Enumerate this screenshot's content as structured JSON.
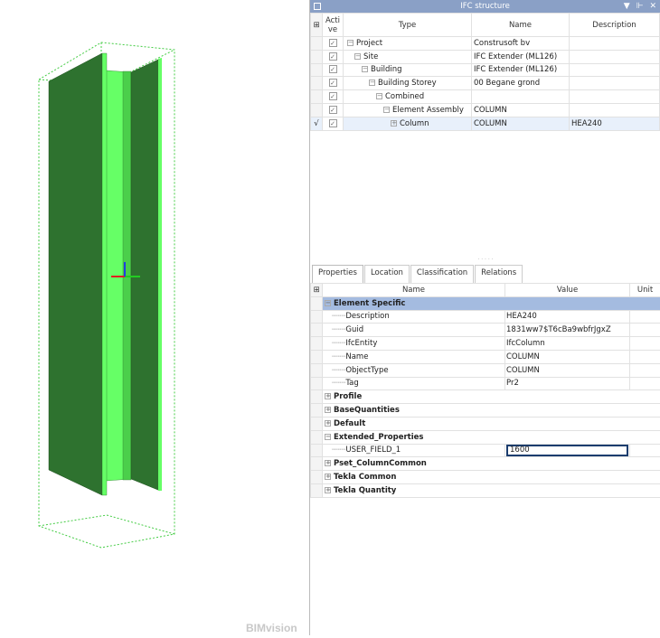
{
  "viewport": {
    "watermark": "BIMvision",
    "colors": {
      "flange": "#2e722f",
      "web": "#66ff66",
      "bbox": "#44cc44",
      "axis_x": "#e02020",
      "axis_y": "#22cc22",
      "axis_z": "#2040e0"
    }
  },
  "ifc_structure": {
    "title": "IFC structure",
    "columns": {
      "active": "Active",
      "type": "Type",
      "name": "Name",
      "description": "Description"
    },
    "rows": [
      {
        "type": "Project",
        "name": "Construsoft bv",
        "description": "",
        "level": 0,
        "expander": "−",
        "mark": ""
      },
      {
        "type": "Site",
        "name": "IFC Extender (ML126)",
        "description": "",
        "level": 1,
        "expander": "−",
        "mark": ""
      },
      {
        "type": "Building",
        "name": "IFC Extender (ML126)",
        "description": "",
        "level": 2,
        "expander": "−",
        "mark": ""
      },
      {
        "type": "Building Storey",
        "name": "00 Begane grond",
        "description": "",
        "level": 3,
        "expander": "−",
        "mark": ""
      },
      {
        "type": "Combined",
        "name": "",
        "description": "",
        "level": 4,
        "expander": "−",
        "mark": ""
      },
      {
        "type": "Element Assembly",
        "name": "COLUMN",
        "description": "",
        "level": 5,
        "expander": "−",
        "mark": ""
      },
      {
        "type": "Column",
        "name": "COLUMN",
        "description": "HEA240",
        "level": 6,
        "expander": "+",
        "mark": "√"
      }
    ]
  },
  "tabs": [
    "Properties",
    "Location",
    "Classification",
    "Relations"
  ],
  "properties": {
    "columns": {
      "name": "Name",
      "value": "Value",
      "unit": "Unit"
    },
    "groups": [
      {
        "label": "Element Specific",
        "expanded": true,
        "items": [
          {
            "name": "Description",
            "value": "HEA240"
          },
          {
            "name": "Guid",
            "value": "1831ww7$T6cBa9wbfrJgxZ"
          },
          {
            "name": "IfcEntity",
            "value": "IfcColumn"
          },
          {
            "name": "Name",
            "value": "COLUMN"
          },
          {
            "name": "ObjectType",
            "value": "COLUMN"
          },
          {
            "name": "Tag",
            "value": "Pr2"
          }
        ]
      },
      {
        "label": "Profile",
        "expanded": false,
        "items": []
      },
      {
        "label": "BaseQuantities",
        "expanded": false,
        "items": []
      },
      {
        "label": "Default",
        "expanded": false,
        "items": []
      },
      {
        "label": "Extended_Properties",
        "expanded": true,
        "items": [
          {
            "name": "USER_FIELD_1",
            "value": "1600",
            "editing": true
          }
        ]
      },
      {
        "label": "Pset_ColumnCommon",
        "expanded": false,
        "items": []
      },
      {
        "label": "Tekla Common",
        "expanded": false,
        "items": []
      },
      {
        "label": "Tekla Quantity",
        "expanded": false,
        "items": []
      }
    ]
  }
}
